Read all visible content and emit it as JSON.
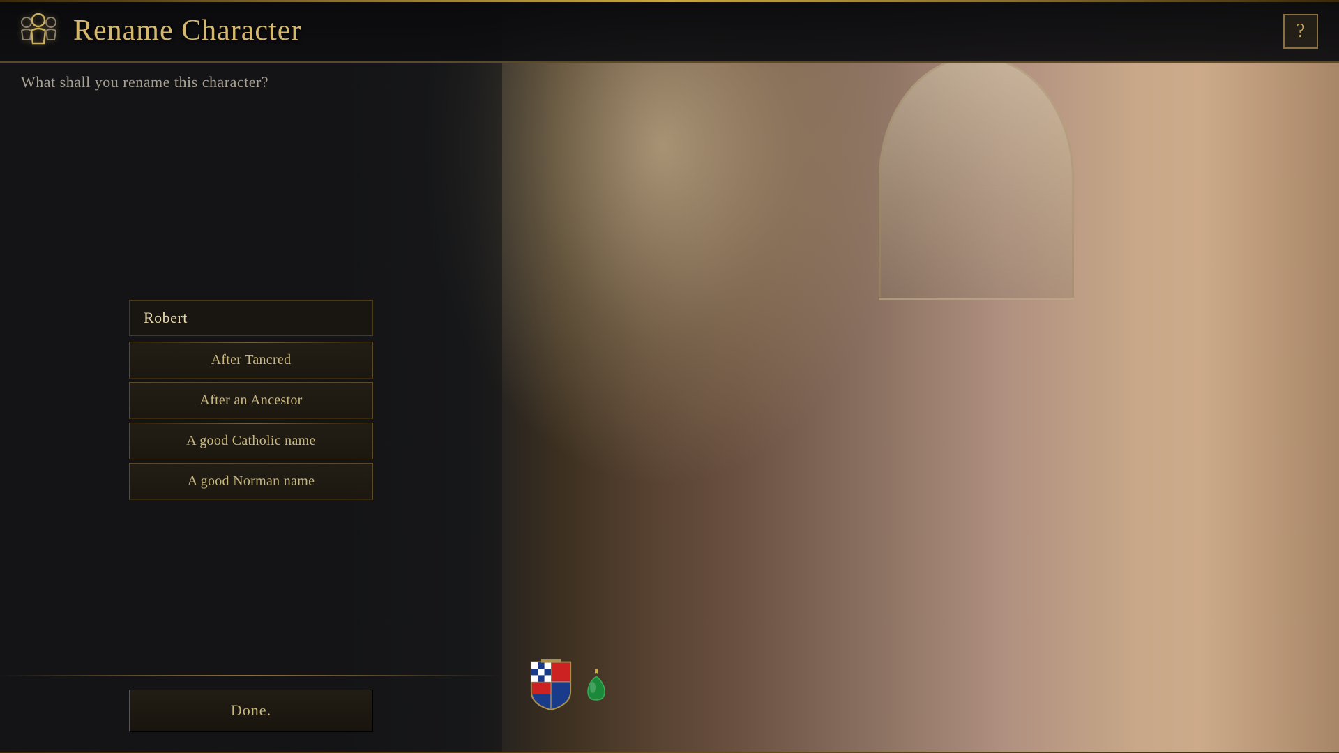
{
  "header": {
    "title": "Rename Character",
    "icon_label": "character-icon",
    "help_label": "?"
  },
  "subtitle": "What shall you rename this character?",
  "options_panel": {
    "current_name": "Robert",
    "buttons": [
      {
        "id": "after-tancred",
        "label": "After Tancred"
      },
      {
        "id": "after-ancestor",
        "label": "After an Ancestor"
      },
      {
        "id": "catholic-name",
        "label": "A good Catholic name"
      },
      {
        "id": "norman-name",
        "label": "A good Norman name"
      }
    ],
    "done_label": "Done."
  },
  "colors": {
    "gold": "#d4b870",
    "text_primary": "#c8b880",
    "text_muted": "#a8a090",
    "border": "#5a4a2a",
    "bg_dark": "#141416"
  }
}
